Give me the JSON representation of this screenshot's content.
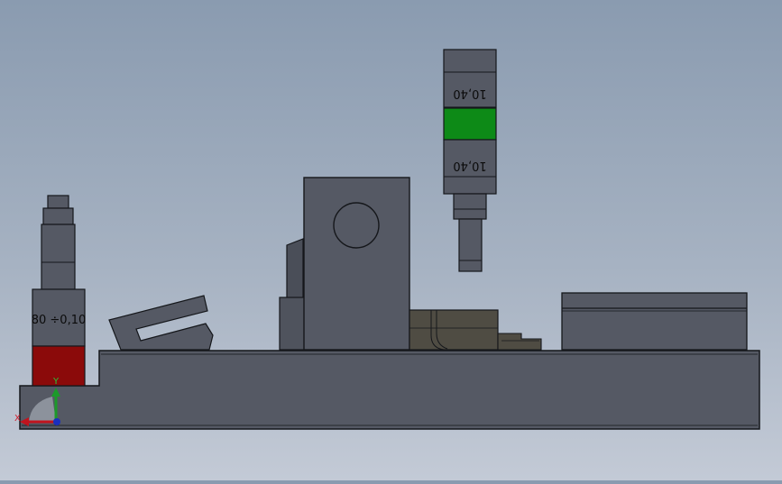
{
  "left_gauge": {
    "label": "80 ÷0,10",
    "band_color": "#8b0a0a"
  },
  "right_gauge": {
    "label_top": "10,40",
    "label_bottom": "10,40",
    "band_color": "#0d8a17"
  },
  "triad": {
    "x_label": "X",
    "y_label": "Y",
    "x_color": "#c0141e",
    "y_color": "#1c9a2a",
    "z_color": "#1a2fbf"
  },
  "colors": {
    "part_fill": "#555964",
    "part_dark": "#454955",
    "edge": "#15171b",
    "bronze": "#4f4c43"
  }
}
